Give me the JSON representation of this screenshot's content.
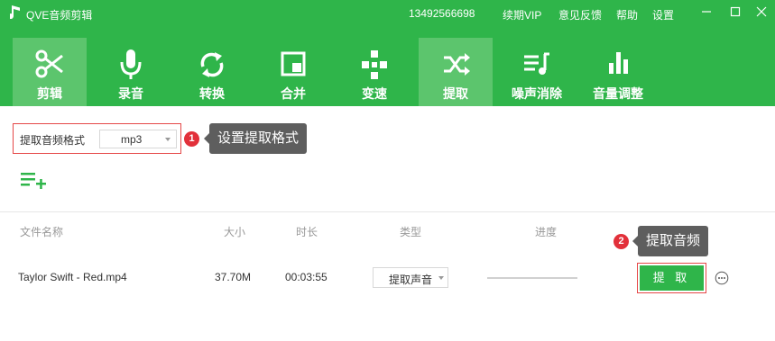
{
  "titlebar": {
    "app_title": "QVE音频剪辑",
    "phone": "13492566698",
    "menu": [
      "续期VIP",
      "意见反馈",
      "帮助",
      "设置"
    ]
  },
  "tabs": [
    {
      "label": "剪辑",
      "icon": "scissors-icon",
      "active": false
    },
    {
      "label": "录音",
      "icon": "microphone-icon",
      "active": false
    },
    {
      "label": "转换",
      "icon": "convert-icon",
      "active": false
    },
    {
      "label": "合并",
      "icon": "merge-icon",
      "active": false
    },
    {
      "label": "变速",
      "icon": "speed-icon",
      "active": false
    },
    {
      "label": "提取",
      "icon": "shuffle-icon",
      "active": true
    },
    {
      "label": "噪声消除",
      "icon": "noise-removal-icon",
      "active": false
    },
    {
      "label": "音量调整",
      "icon": "volume-bars-icon",
      "active": false
    }
  ],
  "format": {
    "label": "提取音频格式",
    "value": "mp3"
  },
  "callouts": [
    {
      "number": "1",
      "text": "设置提取格式"
    },
    {
      "number": "2",
      "text": "提取音频"
    }
  ],
  "table": {
    "headers": [
      "文件名称",
      "大小",
      "时长",
      "类型",
      "进度"
    ],
    "rows": [
      {
        "name": "Taylor Swift - Red.mp4",
        "size": "37.70M",
        "duration": "00:03:55",
        "type": "提取声音",
        "progress": 0,
        "action": "提 取"
      }
    ]
  },
  "colors": {
    "accent": "#2fb54a",
    "active_tab": "#5cc56d",
    "highlight": "#e54747",
    "tooltip": "#5e5e5e"
  }
}
